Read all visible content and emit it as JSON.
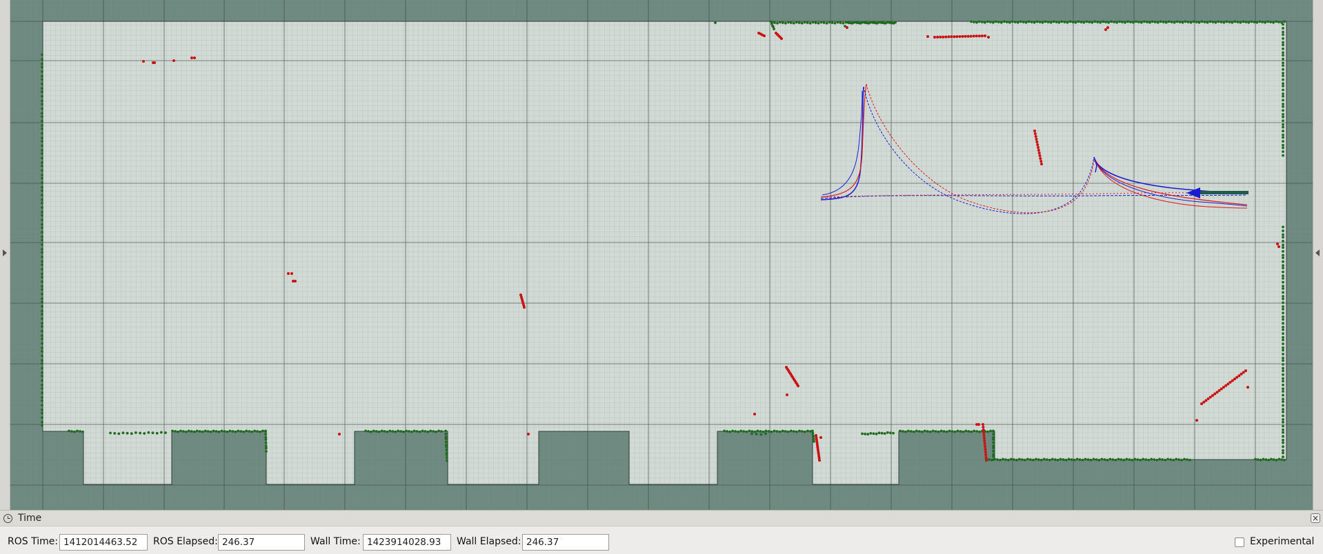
{
  "panel": {
    "title": "Time",
    "close_glyph": "×"
  },
  "time": {
    "ros_time_label": "ROS Time:",
    "ros_time_value": "1412014463.52",
    "ros_elapsed_label": "ROS Elapsed:",
    "ros_elapsed_value": "246.37",
    "wall_time_label": "Wall Time:",
    "wall_time_value": "1423914028.93",
    "wall_elapsed_label": "Wall Elapsed:",
    "wall_elapsed_value": "246.37",
    "experimental_label": "Experimental",
    "experimental_checked": false
  },
  "colors": {
    "map_free": "#d2dad6",
    "map_unknown": "#6e8a80",
    "grid_major": "#3c4a44",
    "laser_hits": "#cc1111",
    "map_points": "#1f6b1f",
    "path_blue": "#1b1bd0",
    "path_red": "#e01818",
    "pose_arrow": "#1f5c4a"
  },
  "icons": [
    "clock-icon",
    "close-icon",
    "expand-left-icon",
    "expand-right-icon",
    "checkbox-icon"
  ]
}
